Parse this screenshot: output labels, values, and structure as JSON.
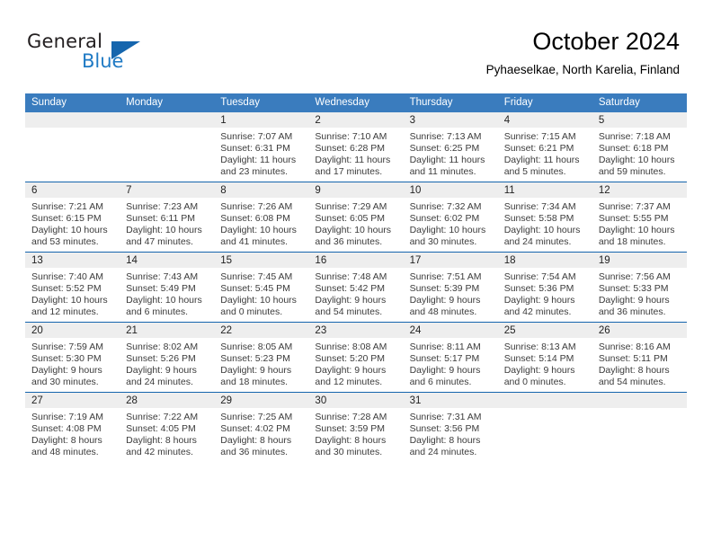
{
  "brand": {
    "name_part1": "General",
    "name_part2": "Blue",
    "logo_icon": "triangle-logo-icon",
    "accent_color": "#1565ad",
    "blue_text_color": "#1f7ac4"
  },
  "header": {
    "title": "October 2024",
    "location": "Pyhaeselkae, North Karelia, Finland"
  },
  "calendar": {
    "header_bg": "#3a7cbe",
    "row_divider_color": "#1565ad",
    "daynum_band_bg": "#eeeeee",
    "weekday_headers": [
      "Sunday",
      "Monday",
      "Tuesday",
      "Wednesday",
      "Thursday",
      "Friday",
      "Saturday"
    ],
    "weeks": [
      [
        {
          "day": ""
        },
        {
          "day": ""
        },
        {
          "day": "1",
          "sunrise": "Sunrise: 7:07 AM",
          "sunset": "Sunset: 6:31 PM",
          "daylight_line1": "Daylight: 11 hours",
          "daylight_line2": "and 23 minutes."
        },
        {
          "day": "2",
          "sunrise": "Sunrise: 7:10 AM",
          "sunset": "Sunset: 6:28 PM",
          "daylight_line1": "Daylight: 11 hours",
          "daylight_line2": "and 17 minutes."
        },
        {
          "day": "3",
          "sunrise": "Sunrise: 7:13 AM",
          "sunset": "Sunset: 6:25 PM",
          "daylight_line1": "Daylight: 11 hours",
          "daylight_line2": "and 11 minutes."
        },
        {
          "day": "4",
          "sunrise": "Sunrise: 7:15 AM",
          "sunset": "Sunset: 6:21 PM",
          "daylight_line1": "Daylight: 11 hours",
          "daylight_line2": "and 5 minutes."
        },
        {
          "day": "5",
          "sunrise": "Sunrise: 7:18 AM",
          "sunset": "Sunset: 6:18 PM",
          "daylight_line1": "Daylight: 10 hours",
          "daylight_line2": "and 59 minutes."
        }
      ],
      [
        {
          "day": "6",
          "sunrise": "Sunrise: 7:21 AM",
          "sunset": "Sunset: 6:15 PM",
          "daylight_line1": "Daylight: 10 hours",
          "daylight_line2": "and 53 minutes."
        },
        {
          "day": "7",
          "sunrise": "Sunrise: 7:23 AM",
          "sunset": "Sunset: 6:11 PM",
          "daylight_line1": "Daylight: 10 hours",
          "daylight_line2": "and 47 minutes."
        },
        {
          "day": "8",
          "sunrise": "Sunrise: 7:26 AM",
          "sunset": "Sunset: 6:08 PM",
          "daylight_line1": "Daylight: 10 hours",
          "daylight_line2": "and 41 minutes."
        },
        {
          "day": "9",
          "sunrise": "Sunrise: 7:29 AM",
          "sunset": "Sunset: 6:05 PM",
          "daylight_line1": "Daylight: 10 hours",
          "daylight_line2": "and 36 minutes."
        },
        {
          "day": "10",
          "sunrise": "Sunrise: 7:32 AM",
          "sunset": "Sunset: 6:02 PM",
          "daylight_line1": "Daylight: 10 hours",
          "daylight_line2": "and 30 minutes."
        },
        {
          "day": "11",
          "sunrise": "Sunrise: 7:34 AM",
          "sunset": "Sunset: 5:58 PM",
          "daylight_line1": "Daylight: 10 hours",
          "daylight_line2": "and 24 minutes."
        },
        {
          "day": "12",
          "sunrise": "Sunrise: 7:37 AM",
          "sunset": "Sunset: 5:55 PM",
          "daylight_line1": "Daylight: 10 hours",
          "daylight_line2": "and 18 minutes."
        }
      ],
      [
        {
          "day": "13",
          "sunrise": "Sunrise: 7:40 AM",
          "sunset": "Sunset: 5:52 PM",
          "daylight_line1": "Daylight: 10 hours",
          "daylight_line2": "and 12 minutes."
        },
        {
          "day": "14",
          "sunrise": "Sunrise: 7:43 AM",
          "sunset": "Sunset: 5:49 PM",
          "daylight_line1": "Daylight: 10 hours",
          "daylight_line2": "and 6 minutes."
        },
        {
          "day": "15",
          "sunrise": "Sunrise: 7:45 AM",
          "sunset": "Sunset: 5:45 PM",
          "daylight_line1": "Daylight: 10 hours",
          "daylight_line2": "and 0 minutes."
        },
        {
          "day": "16",
          "sunrise": "Sunrise: 7:48 AM",
          "sunset": "Sunset: 5:42 PM",
          "daylight_line1": "Daylight: 9 hours",
          "daylight_line2": "and 54 minutes."
        },
        {
          "day": "17",
          "sunrise": "Sunrise: 7:51 AM",
          "sunset": "Sunset: 5:39 PM",
          "daylight_line1": "Daylight: 9 hours",
          "daylight_line2": "and 48 minutes."
        },
        {
          "day": "18",
          "sunrise": "Sunrise: 7:54 AM",
          "sunset": "Sunset: 5:36 PM",
          "daylight_line1": "Daylight: 9 hours",
          "daylight_line2": "and 42 minutes."
        },
        {
          "day": "19",
          "sunrise": "Sunrise: 7:56 AM",
          "sunset": "Sunset: 5:33 PM",
          "daylight_line1": "Daylight: 9 hours",
          "daylight_line2": "and 36 minutes."
        }
      ],
      [
        {
          "day": "20",
          "sunrise": "Sunrise: 7:59 AM",
          "sunset": "Sunset: 5:30 PM",
          "daylight_line1": "Daylight: 9 hours",
          "daylight_line2": "and 30 minutes."
        },
        {
          "day": "21",
          "sunrise": "Sunrise: 8:02 AM",
          "sunset": "Sunset: 5:26 PM",
          "daylight_line1": "Daylight: 9 hours",
          "daylight_line2": "and 24 minutes."
        },
        {
          "day": "22",
          "sunrise": "Sunrise: 8:05 AM",
          "sunset": "Sunset: 5:23 PM",
          "daylight_line1": "Daylight: 9 hours",
          "daylight_line2": "and 18 minutes."
        },
        {
          "day": "23",
          "sunrise": "Sunrise: 8:08 AM",
          "sunset": "Sunset: 5:20 PM",
          "daylight_line1": "Daylight: 9 hours",
          "daylight_line2": "and 12 minutes."
        },
        {
          "day": "24",
          "sunrise": "Sunrise: 8:11 AM",
          "sunset": "Sunset: 5:17 PM",
          "daylight_line1": "Daylight: 9 hours",
          "daylight_line2": "and 6 minutes."
        },
        {
          "day": "25",
          "sunrise": "Sunrise: 8:13 AM",
          "sunset": "Sunset: 5:14 PM",
          "daylight_line1": "Daylight: 9 hours",
          "daylight_line2": "and 0 minutes."
        },
        {
          "day": "26",
          "sunrise": "Sunrise: 8:16 AM",
          "sunset": "Sunset: 5:11 PM",
          "daylight_line1": "Daylight: 8 hours",
          "daylight_line2": "and 54 minutes."
        }
      ],
      [
        {
          "day": "27",
          "sunrise": "Sunrise: 7:19 AM",
          "sunset": "Sunset: 4:08 PM",
          "daylight_line1": "Daylight: 8 hours",
          "daylight_line2": "and 48 minutes."
        },
        {
          "day": "28",
          "sunrise": "Sunrise: 7:22 AM",
          "sunset": "Sunset: 4:05 PM",
          "daylight_line1": "Daylight: 8 hours",
          "daylight_line2": "and 42 minutes."
        },
        {
          "day": "29",
          "sunrise": "Sunrise: 7:25 AM",
          "sunset": "Sunset: 4:02 PM",
          "daylight_line1": "Daylight: 8 hours",
          "daylight_line2": "and 36 minutes."
        },
        {
          "day": "30",
          "sunrise": "Sunrise: 7:28 AM",
          "sunset": "Sunset: 3:59 PM",
          "daylight_line1": "Daylight: 8 hours",
          "daylight_line2": "and 30 minutes."
        },
        {
          "day": "31",
          "sunrise": "Sunrise: 7:31 AM",
          "sunset": "Sunset: 3:56 PM",
          "daylight_line1": "Daylight: 8 hours",
          "daylight_line2": "and 24 minutes."
        },
        {
          "day": ""
        },
        {
          "day": ""
        }
      ]
    ]
  }
}
